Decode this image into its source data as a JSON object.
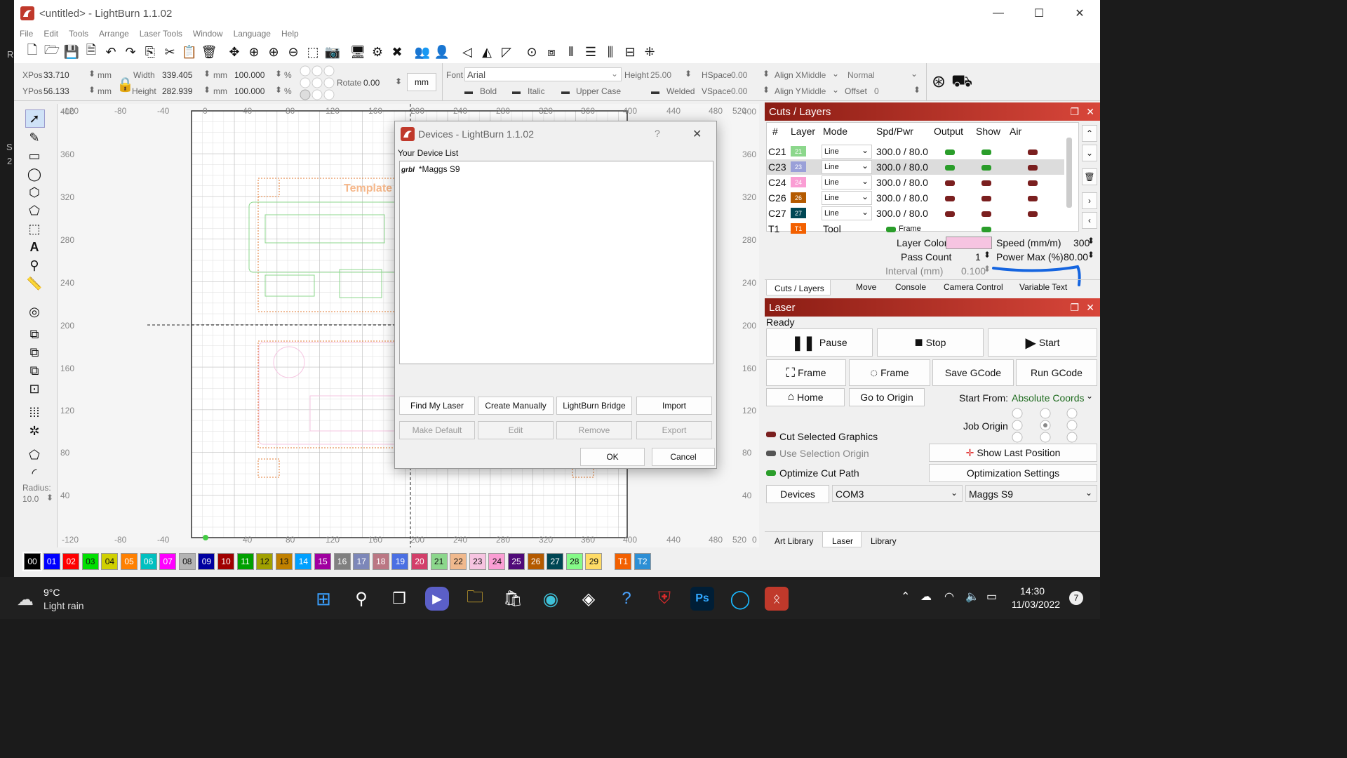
{
  "window": {
    "title": "<untitled> - LightBurn 1.1.02",
    "minimize": "—",
    "maximize": "☐",
    "close": "✕"
  },
  "left_margin": [
    "R",
    "S",
    "2"
  ],
  "menu": [
    "File",
    "Edit",
    "Tools",
    "Arrange",
    "Laser Tools",
    "Window",
    "Language",
    "Help"
  ],
  "toolbar_icons": [
    "new-file-icon",
    "open-folder-icon",
    "save-icon",
    "save-as-icon",
    "undo-icon",
    "redo-icon",
    "copy-icon",
    "cut-icon",
    "paste-icon",
    "delete-icon",
    "move-icon",
    "zoom-in-icon",
    "zoom-in-icon",
    "zoom-out-icon",
    "zoom-frame-icon",
    "camera-icon",
    "monitor-icon",
    "settings-icon",
    "tools-icon",
    "group-icon",
    "ungroup-icon",
    "flip-h-icon",
    "mirror-icon",
    "mirror-v-icon",
    "align-center-icon",
    "align-icon",
    "distribute-icon",
    "distribute-v-icon",
    "dock-icon",
    "push-icon",
    "move-laser-icon"
  ],
  "props": {
    "xpos_label": "XPos",
    "xpos": "33.710",
    "ypos_label": "YPos",
    "ypos": "56.133",
    "unit": "mm",
    "width_label": "Width",
    "width": "339.405",
    "height_label": "Height",
    "height": "282.939",
    "pct1": "100.000",
    "pct2": "100.000",
    "pct_unit": "%",
    "rotate_label": "Rotate",
    "rotate": "0.00",
    "units_btn": "mm",
    "font_label": "Font",
    "font": "Arial",
    "fheight_label": "Height",
    "fheight": "25.00",
    "hspace_label": "HSpace",
    "hspace": "0.00",
    "vspace_label": "VSpace",
    "vspace": "0.00",
    "alignx_label": "Align X",
    "alignx": "Middle",
    "aligny_label": "Align Y",
    "aligny": "Middle",
    "normal": "Normal",
    "offset_label": "Offset",
    "offset": "0",
    "bold": "Bold",
    "italic": "Italic",
    "upper": "Upper Case",
    "welded": "Welded"
  },
  "tools": {
    "radius_label": "Radius:",
    "radius": "10.0"
  },
  "canvas": {
    "x_ticks": [
      "-120",
      "-80",
      "-40",
      "0",
      "40",
      "80",
      "120",
      "160",
      "200",
      "240",
      "280",
      "320",
      "360",
      "400",
      "440",
      "480",
      "520"
    ],
    "y_ticks": [
      "400",
      "360",
      "320",
      "280",
      "240",
      "200",
      "160",
      "120",
      "80",
      "40",
      "0"
    ],
    "template_text": "Template f"
  },
  "palette": [
    {
      "n": "00",
      "c": "#000000"
    },
    {
      "n": "01",
      "c": "#0000ff"
    },
    {
      "n": "02",
      "c": "#ff0000"
    },
    {
      "n": "03",
      "c": "#00e000"
    },
    {
      "n": "04",
      "c": "#d0d000"
    },
    {
      "n": "05",
      "c": "#ff8000"
    },
    {
      "n": "06",
      "c": "#00c0c0"
    },
    {
      "n": "07",
      "c": "#ff00ff"
    },
    {
      "n": "08",
      "c": "#b4b4b4"
    },
    {
      "n": "09",
      "c": "#0000a0"
    },
    {
      "n": "10",
      "c": "#a00000"
    },
    {
      "n": "11",
      "c": "#00a000"
    },
    {
      "n": "12",
      "c": "#a0a000"
    },
    {
      "n": "13",
      "c": "#c08000"
    },
    {
      "n": "14",
      "c": "#00a0ff"
    },
    {
      "n": "15",
      "c": "#a000a0"
    },
    {
      "n": "16",
      "c": "#808080"
    },
    {
      "n": "17",
      "c": "#7d87b9"
    },
    {
      "n": "18",
      "c": "#bb7784"
    },
    {
      "n": "19",
      "c": "#4a6fe3"
    },
    {
      "n": "20",
      "c": "#d33f6a"
    },
    {
      "n": "21",
      "c": "#8cd78c"
    },
    {
      "n": "22",
      "c": "#f0b98d"
    },
    {
      "n": "23",
      "c": "#f6c4e1"
    },
    {
      "n": "24",
      "c": "#fa9ed4"
    },
    {
      "n": "25",
      "c": "#500a78"
    },
    {
      "n": "26",
      "c": "#b45a00"
    },
    {
      "n": "27",
      "c": "#004754"
    },
    {
      "n": "28",
      "c": "#86fa88"
    },
    {
      "n": "29",
      "c": "#ffdb66"
    },
    {
      "n": "T1",
      "c": "#f36000"
    },
    {
      "n": "T2",
      "c": "#2d8fd5"
    }
  ],
  "cuts": {
    "title": "Cuts / Layers",
    "headers": [
      "#",
      "Layer",
      "Mode",
      "Spd/Pwr",
      "Output",
      "Show",
      "Air"
    ],
    "rows": [
      {
        "id": "C21",
        "num": "21",
        "color": "#8cd78c",
        "mode": "Line",
        "sp": "300.0 / 80.0"
      },
      {
        "id": "C23",
        "num": "23",
        "color": "#9aa0d8",
        "mode": "Line",
        "sp": "300.0 / 80.0"
      },
      {
        "id": "C24",
        "num": "24",
        "color": "#fa9ed4",
        "mode": "Line",
        "sp": "300.0 / 80.0"
      },
      {
        "id": "C26",
        "num": "26",
        "color": "#b45a00",
        "mode": "Line",
        "sp": "300.0 / 80.0"
      },
      {
        "id": "C27",
        "num": "27",
        "color": "#004754",
        "mode": "Line",
        "sp": "300.0 / 80.0"
      }
    ],
    "tool_row": {
      "id": "T1",
      "num": "T1",
      "color": "#f36000",
      "mode": "Tool",
      "sp": "Frame"
    },
    "layer_color_label": "Layer Color",
    "speed_label": "Speed (mm/m)",
    "speed": "300",
    "pass_label": "Pass Count",
    "pass": "1",
    "power_label": "Power Max (%)",
    "power": "80.00",
    "interval_label": "Interval (mm)",
    "interval": "0.100",
    "tabs": [
      "Cuts / Layers",
      "Move",
      "Console",
      "Camera Control",
      "Variable Text"
    ]
  },
  "laser": {
    "title": "Laser",
    "status": "Ready",
    "pause": "Pause",
    "stop": "Stop",
    "start": "Start",
    "frame1": "Frame",
    "frame2": "Frame",
    "save_gcode": "Save GCode",
    "run_gcode": "Run GCode",
    "home": "Home",
    "origin": "Go to Origin",
    "start_from_label": "Start From:",
    "start_from": "Absolute Coords",
    "job_origin": "Job Origin",
    "cut_selected": "Cut Selected Graphics",
    "use_selection": "Use Selection Origin",
    "optimize": "Optimize Cut Path",
    "show_last": "Show Last Position",
    "opt_settings": "Optimization Settings",
    "devices": "Devices",
    "port": "COM3",
    "device": "Maggs S9",
    "tabs": [
      "Art Library",
      "Laser",
      "Library"
    ]
  },
  "dialog": {
    "title": "Devices - LightBurn 1.1.02",
    "help": "?",
    "close": "✕",
    "list_label": "Your Device List",
    "device_tag": "grbl",
    "device_name": "*Maggs S9",
    "find": "Find My Laser",
    "create": "Create Manually",
    "bridge": "LightBurn Bridge",
    "import": "Import",
    "make_default": "Make Default",
    "edit": "Edit",
    "remove": "Remove",
    "export": "Export",
    "ok": "OK",
    "cancel": "Cancel"
  },
  "taskbar": {
    "temp": "9°C",
    "weather": "Light rain",
    "time": "14:30",
    "date": "11/03/2022",
    "notif": "7"
  }
}
